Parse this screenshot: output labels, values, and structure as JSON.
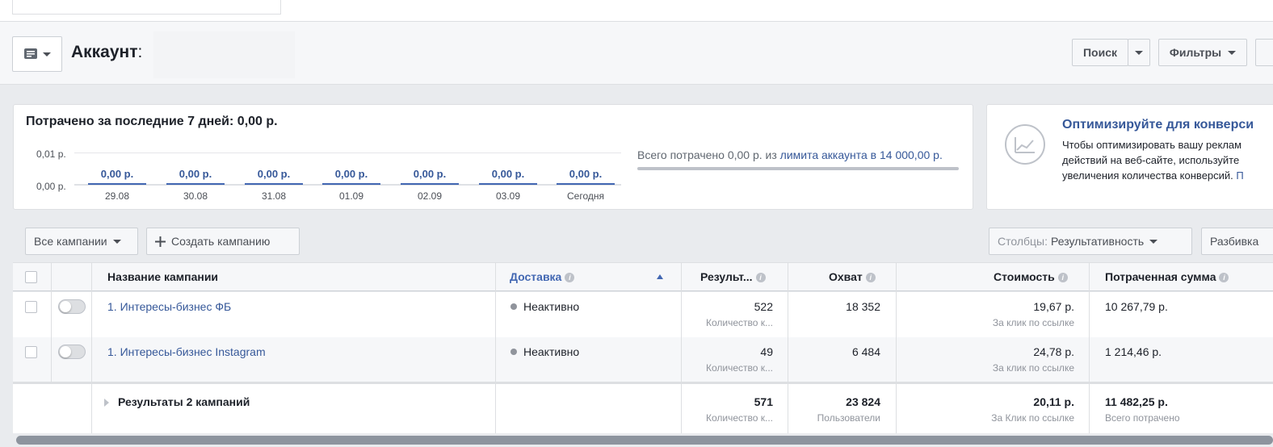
{
  "header": {
    "account_label": "Аккаунт",
    "account_colon": ":",
    "search_button": "Поиск",
    "filters_button": "Фильтры"
  },
  "spend": {
    "title": "Потрачено за последние 7 дней: 0,00 р.",
    "y_top": "0,01 р.",
    "y_bottom": "0,00 р.",
    "days": [
      {
        "value": "0,00 р.",
        "date": "29.08"
      },
      {
        "value": "0,00 р.",
        "date": "30.08"
      },
      {
        "value": "0,00 р.",
        "date": "31.08"
      },
      {
        "value": "0,00 р.",
        "date": "01.09"
      },
      {
        "value": "0,00 р.",
        "date": "02.09"
      },
      {
        "value": "0,00 р.",
        "date": "03.09"
      },
      {
        "value": "0,00 р.",
        "date": "Сегодня"
      }
    ],
    "total_prefix": "Всего потрачено 0,00 р. из ",
    "total_link": "лимита аккаунта в 14 000,00 р."
  },
  "optimize": {
    "title": "Оптимизируйте для конверси",
    "line1": "Чтобы оптимизировать вашу реклам",
    "line2": "действий на веб-сайте, используйте",
    "line3": "увеличения количества конверсий. ",
    "line3_link": "П"
  },
  "toolbar": {
    "all_campaigns": "Все кампании",
    "create_campaign": "Создать кампанию",
    "columns_label": "Столбцы:",
    "columns_value": "Результативность",
    "breakdown": "Разбивка"
  },
  "table": {
    "headers": {
      "name": "Название кампании",
      "delivery": "Доставка",
      "results": "Результ...",
      "reach": "Охват",
      "cost": "Стоимость",
      "spent": "Потраченная сумма"
    },
    "rows": [
      {
        "name": "1. Интересы-бизнес ФБ",
        "delivery": "Неактивно",
        "results": "522",
        "results_sub": "Количество к...",
        "reach": "18 352",
        "cost": "19,67 р.",
        "cost_sub": "За клик по ссылке",
        "spent": "10 267,79 р."
      },
      {
        "name": "1. Интересы-бизнес Instagram",
        "delivery": "Неактивно",
        "results": "49",
        "results_sub": "Количество к...",
        "reach": "6 484",
        "cost": "24,78 р.",
        "cost_sub": "За клик по ссылке",
        "spent": "1 214,46 р."
      }
    ],
    "summary": {
      "label": "Результаты 2 кампаний",
      "results": "571",
      "results_sub": "Количество к...",
      "reach": "23 824",
      "reach_sub": "Пользователи",
      "cost": "20,11 р.",
      "cost_sub": "За Клик по ссылке",
      "spent": "11 482,25 р.",
      "spent_sub": "Всего потрачено"
    }
  }
}
